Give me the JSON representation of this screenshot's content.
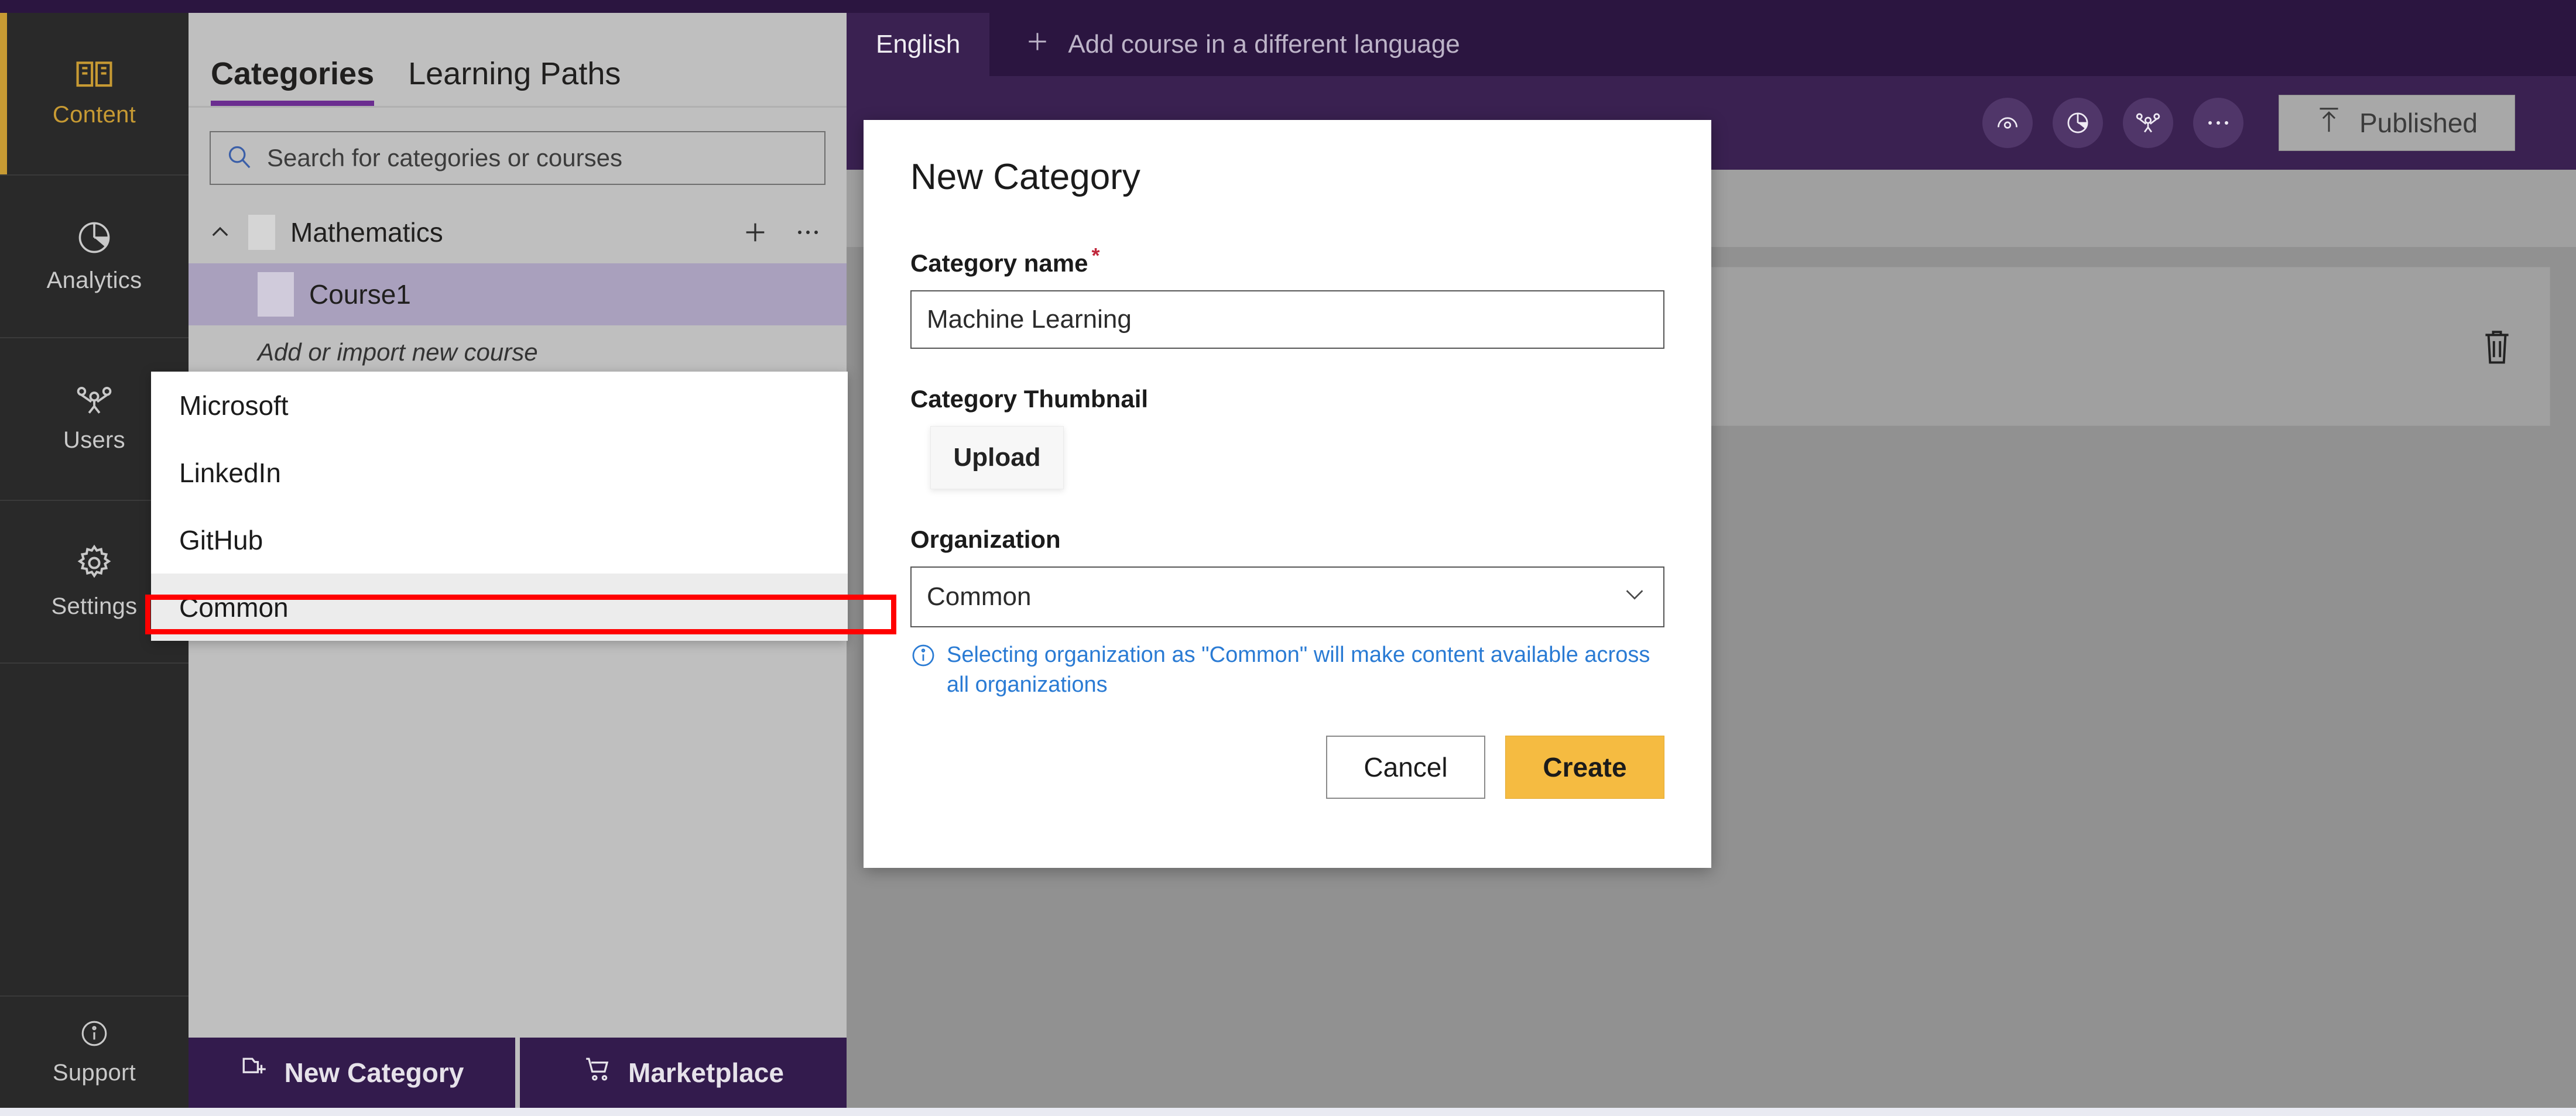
{
  "rail": {
    "items": [
      {
        "label": "Content",
        "icon": "book-icon",
        "active": true
      },
      {
        "label": "Analytics",
        "icon": "pie-chart-icon",
        "active": false
      },
      {
        "label": "Users",
        "icon": "people-icon",
        "active": false
      },
      {
        "label": "Settings",
        "icon": "gear-icon",
        "active": false
      }
    ],
    "support": {
      "label": "Support",
      "icon": "info-circle-icon"
    },
    "accent": "#c79a33"
  },
  "panel": {
    "tabs": [
      {
        "label": "Categories",
        "active": true
      },
      {
        "label": "Learning Paths",
        "active": false
      }
    ],
    "search": {
      "placeholder": "Search for categories or courses",
      "value": "",
      "icon": "search-icon"
    },
    "tree": {
      "category": {
        "name": "Mathematics",
        "collapse_icon": "chevron-up-icon",
        "add_icon": "plus-icon",
        "more_icon": "ellipsis-icon"
      },
      "course": {
        "name": "Course1"
      },
      "add_import": "Add or import new course"
    },
    "footer": [
      {
        "label": "New Category",
        "icon": "new-folder-icon"
      },
      {
        "label": "Marketplace",
        "icon": "cart-icon"
      }
    ]
  },
  "main": {
    "language_tab": "English",
    "add_language": {
      "label": "Add course in a different language",
      "icon": "plus-icon"
    },
    "toolbar_icons": [
      {
        "name": "preview-eye-icon"
      },
      {
        "name": "pie-chart-icon"
      },
      {
        "name": "people-icon"
      },
      {
        "name": "ellipsis-icon"
      }
    ],
    "publish": {
      "label": "Published",
      "icon": "upload-arrow-icon"
    },
    "card": {
      "delete_icon": "trash-icon"
    }
  },
  "dropdown": {
    "options": [
      {
        "label": "Microsoft",
        "selected": false
      },
      {
        "label": "LinkedIn",
        "selected": false
      },
      {
        "label": "GitHub",
        "selected": false
      },
      {
        "label": "Common",
        "selected": true
      }
    ],
    "highlight_color": "#ff0000"
  },
  "modal": {
    "title": "New Category",
    "category_name": {
      "label": "Category name",
      "required_mark": "*",
      "value": "Machine Learning",
      "placeholder": "Category name"
    },
    "thumbnail": {
      "label": "Category Thumbnail",
      "upload_label": "Upload"
    },
    "organization": {
      "label": "Organization",
      "value": "Common",
      "chevron": "chevron-down-icon"
    },
    "info": {
      "icon": "info-circle-icon",
      "text": "Selecting organization as \"Common\" will make content available across all organizations",
      "color": "#2a7bd4"
    },
    "buttons": {
      "cancel": "Cancel",
      "create": "Create"
    }
  },
  "theme": {
    "purple_dark": "#2b1540",
    "purple": "#3a2151",
    "accent_gold": "#f5bb41",
    "overlay_gray": "#919191"
  }
}
